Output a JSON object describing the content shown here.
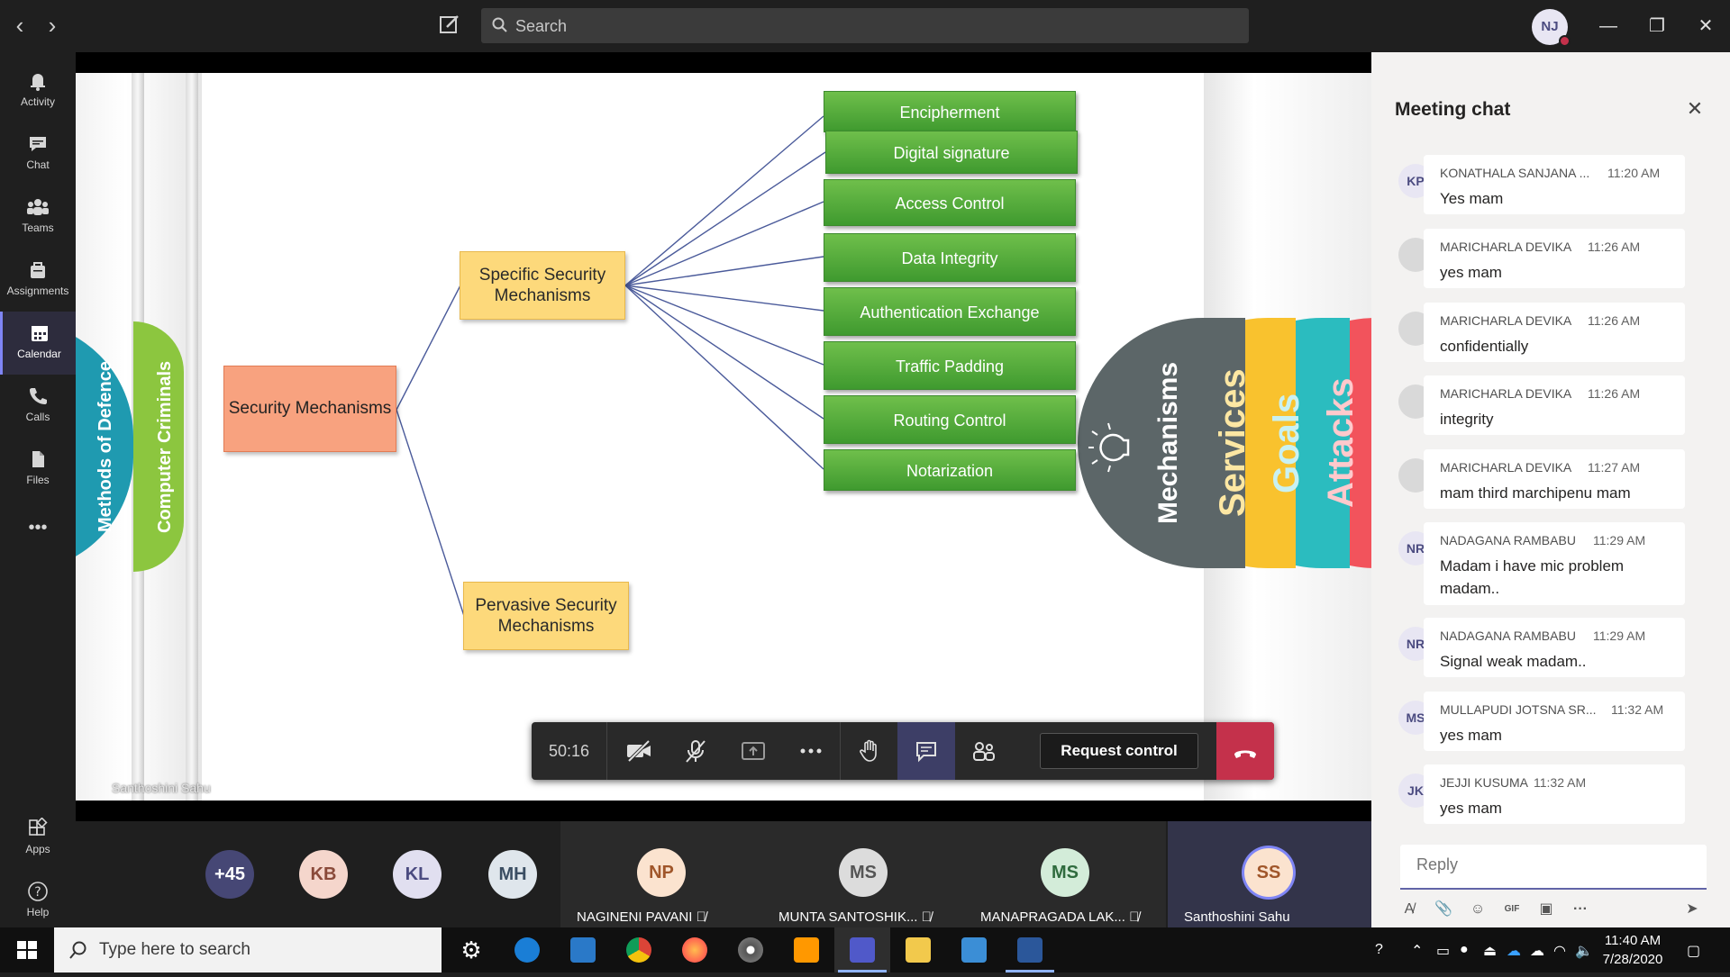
{
  "topbar": {
    "search_placeholder": "Search",
    "user_initials": "NJ"
  },
  "rail": {
    "items": [
      {
        "label": "Activity",
        "icon": "bell-icon"
      },
      {
        "label": "Chat",
        "icon": "chat-icon"
      },
      {
        "label": "Teams",
        "icon": "teams-icon"
      },
      {
        "label": "Assignments",
        "icon": "assignments-icon"
      },
      {
        "label": "Calendar",
        "icon": "calendar-icon",
        "active": true
      },
      {
        "label": "Calls",
        "icon": "phone-icon"
      },
      {
        "label": "Files",
        "icon": "files-icon"
      }
    ],
    "more": "•••",
    "apps_label": "Apps",
    "help_label": "Help"
  },
  "slide": {
    "root": "Security Mechanisms",
    "specific": "Specific Security Mechanisms",
    "pervasive": "Pervasive Security Mechanisms",
    "leaves": [
      "Encipherment",
      "Digital signature",
      "Access Control",
      "Data Integrity",
      "Authentication Exchange",
      "Traffic Padding",
      "Routing Control",
      "Notarization"
    ],
    "left_tabs": [
      "Methods of Defence",
      "Computer Criminals"
    ],
    "right_tabs": [
      "Mechanisms",
      "Services",
      "Goals",
      "Attacks"
    ],
    "presenter": "Santhoshini Sahu"
  },
  "controls": {
    "timer": "50:16",
    "request_control": "Request control"
  },
  "participants": {
    "overflow": "+45",
    "avatars": [
      "KB",
      "KL",
      "MH"
    ],
    "tiles": [
      {
        "initials": "NP",
        "name": "NAGINENI PAVANI"
      },
      {
        "initials": "MS",
        "name": "MUNTA SANTOSHIK..."
      },
      {
        "initials": "MS",
        "name": "MANAPRAGADA LAK..."
      },
      {
        "initials": "SS",
        "name": "Santhoshini Sahu"
      }
    ]
  },
  "chat": {
    "title": "Meeting chat",
    "messages": [
      {
        "initials": "KP",
        "author": "KONATHALA SANJANA ...",
        "time": "11:20 AM",
        "text": "Yes mam"
      },
      {
        "initials": "",
        "author": "MARICHARLA DEVIKA",
        "time": "11:26 AM",
        "text": "yes mam"
      },
      {
        "initials": "",
        "author": "MARICHARLA DEVIKA",
        "time": "11:26 AM",
        "text": "confidentially"
      },
      {
        "initials": "",
        "author": "MARICHARLA DEVIKA",
        "time": "11:26 AM",
        "text": "integrity"
      },
      {
        "initials": "",
        "author": "MARICHARLA DEVIKA",
        "time": "11:27 AM",
        "text": "mam third marchipenu mam"
      },
      {
        "initials": "NR",
        "author": "NADAGANA RAMBABU",
        "time": "11:29 AM",
        "text": "Madam i have mic problem madam.."
      },
      {
        "initials": "NR",
        "author": "NADAGANA RAMBABU",
        "time": "11:29 AM",
        "text": "Signal weak madam.."
      },
      {
        "initials": "MS",
        "author": "MULLAPUDI JOTSNA SR...",
        "time": "11:32 AM",
        "text": "yes mam"
      },
      {
        "initials": "JK",
        "author": "JEJJI KUSUMA",
        "time": "11:32 AM",
        "text": "yes mam"
      }
    ],
    "reply_placeholder": "Reply"
  },
  "taskbar": {
    "search_placeholder": "Type here to search",
    "time": "11:40 AM",
    "date": "7/28/2020"
  }
}
